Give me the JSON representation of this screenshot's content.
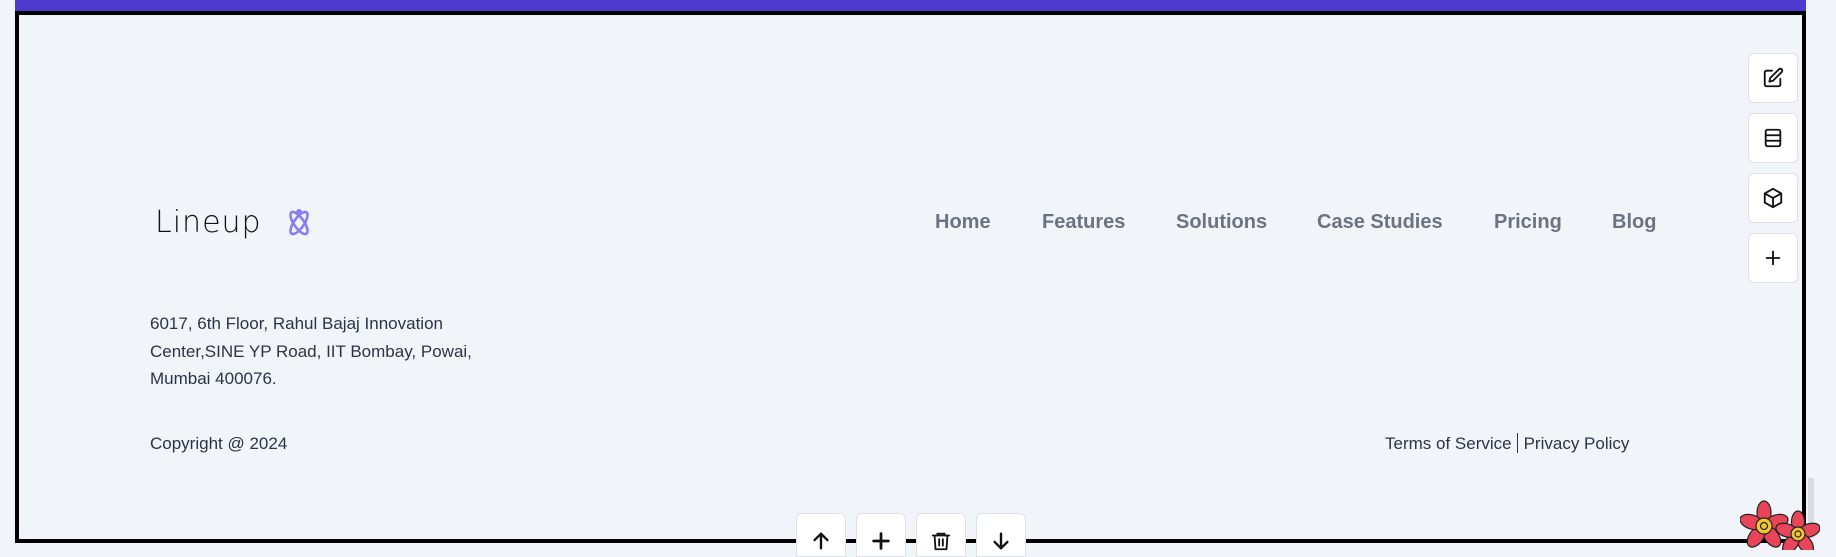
{
  "brand": {
    "logo_text": "Lineup",
    "logo_mark_color": "#8b7cf0",
    "accent_bar_color": "#4d3bd0"
  },
  "nav": {
    "items": [
      {
        "label": "Home"
      },
      {
        "label": "Features"
      },
      {
        "label": "Solutions"
      },
      {
        "label": "Case Studies"
      },
      {
        "label": "Pricing"
      },
      {
        "label": "Blog"
      }
    ]
  },
  "footer": {
    "address_line1": "6017, 6th Floor, Rahul Bajaj Innovation",
    "address_line2": "Center,SINE YP Road, IIT Bombay, Powai,",
    "address_line3": "Mumbai 400076.",
    "copyright": "Copyright @ 2024",
    "terms_label": "Terms of Service",
    "privacy_label": "Privacy Policy"
  },
  "editor_tools": {
    "side": [
      {
        "icon": "edit-icon"
      },
      {
        "icon": "layers-icon"
      },
      {
        "icon": "cube-icon"
      },
      {
        "icon": "plus-icon"
      }
    ],
    "bottom": [
      {
        "icon": "arrow-up-icon"
      },
      {
        "icon": "plus-icon"
      },
      {
        "icon": "trash-icon"
      },
      {
        "icon": "arrow-down-icon"
      }
    ]
  }
}
